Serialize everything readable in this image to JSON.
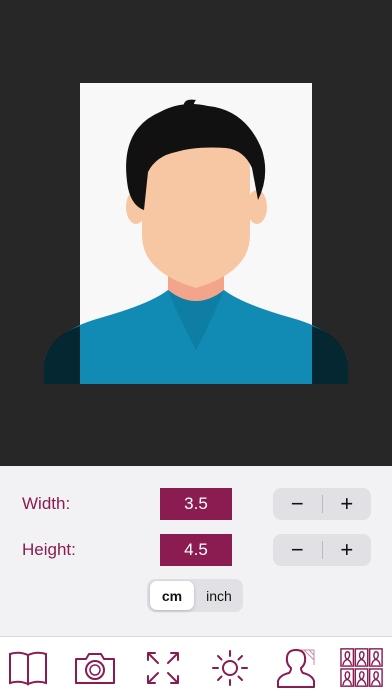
{
  "size": {
    "width_label": "Width:",
    "width_value": "3.5",
    "height_label": "Height:",
    "height_value": "4.5",
    "minus": "−",
    "plus": "+"
  },
  "units": {
    "options": [
      "cm",
      "inch"
    ],
    "selected": "cm"
  },
  "toolbar": {
    "items": [
      "book-icon",
      "camera-icon",
      "expand-icon",
      "brightness-icon",
      "person-silhouette-icon",
      "photo-grid-icon"
    ]
  },
  "colors": {
    "accent": "#8a1c52",
    "preview_background": "#272727",
    "shirt": "#118bb4",
    "skin": "#f7c6a3",
    "hair": "#111111"
  }
}
